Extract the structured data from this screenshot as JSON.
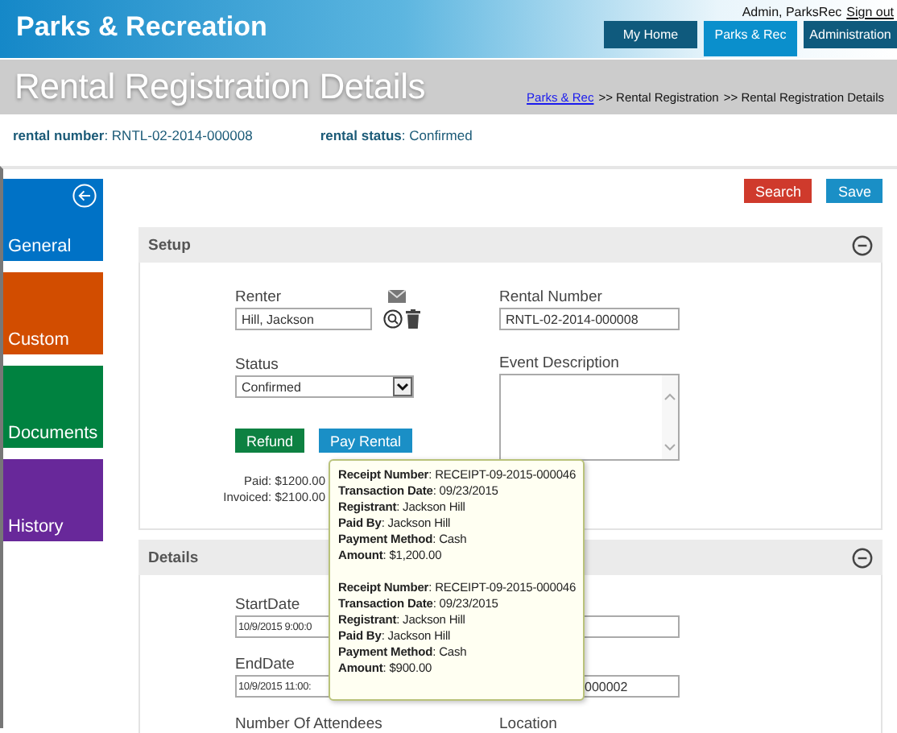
{
  "header": {
    "app_title": "Parks & Recreation",
    "user": "Admin, ParksRec",
    "sign_out": "Sign out",
    "tabs": [
      {
        "label": "My Home",
        "selected": false
      },
      {
        "label": "Parks & Rec",
        "selected": true
      },
      {
        "label": "Administration",
        "selected": false
      }
    ]
  },
  "title_bar": {
    "title": "Rental Registration Details",
    "breadcrumb": [
      {
        "label": "Parks & Rec",
        "kind": "link"
      },
      {
        "label": ">> Rental Registration",
        "kind": "text"
      },
      {
        "label": ">> Rental Registration Details",
        "kind": "text"
      }
    ]
  },
  "summary": [
    "**rental number**: RNTL-02-2014-000008",
    "**rental status**: Confirmed"
  ],
  "sidebar": [
    {
      "label": "General",
      "color": "#0072c6",
      "kind": "back"
    },
    {
      "label": "Custom",
      "color": "#d24d00",
      "kind": "plain"
    },
    {
      "label": "Documents",
      "color": "#008240",
      "kind": "plain"
    },
    {
      "label": "History",
      "color": "#68289a",
      "kind": "plain"
    }
  ],
  "actions": [
    {
      "label": "Search",
      "kind": "danger"
    },
    {
      "label": "Save",
      "kind": "primary"
    }
  ],
  "setup": {
    "title": "Setup",
    "expanded": true,
    "renter": {
      "label": "Renter",
      "value": "Hill, Jackson"
    },
    "status": {
      "label": "Status",
      "value": "Confirmed"
    },
    "buttons": [
      {
        "label": "Refund",
        "kind": "success"
      },
      {
        "label": "Pay Rental",
        "kind": "primary"
      }
    ],
    "paid": "Paid: $1200.00",
    "invoiced": "Invoiced: $2100.00",
    "rental_number": {
      "label": "Rental Number",
      "value": "RNTL-02-2014-000008"
    },
    "event_description": {
      "label": "Event Description"
    }
  },
  "details": {
    "title": "Details",
    "expanded": true,
    "rows": [
      {
        "cells": [
          {
            "label": "StartDate",
            "value": "10/9/2015 9:00:0",
            "kind": "field"
          },
          {
            "kind": "field"
          }
        ]
      },
      {
        "cells": [
          {
            "label": "EndDate",
            "value": "10/9/2015 11:00:",
            "kind": "field"
          },
          {
            "value": "000002",
            "kind": "field"
          }
        ]
      },
      {
        "cells": [
          {
            "label": "Number Of Attendees",
            "kind": "label"
          },
          {
            "label": "Location",
            "kind": "label"
          }
        ]
      }
    ]
  },
  "tooltip": {
    "receipts": [
      {
        "lines": [
          "**Receipt Number**: RECEIPT-09-2015-000046",
          "**Transaction Date**: 09/23/2015",
          "**Registrant**: Jackson Hill",
          "**Paid By**: Jackson Hill",
          "**Payment Method**: Cash",
          "**Amount**: $1,200.00"
        ]
      },
      {
        "lines": [
          "**Receipt Number**: RECEIPT-09-2015-000046",
          "**Transaction Date**: 09/23/2015",
          "**Registrant**: Jackson Hill",
          "**Paid By**: Jackson Hill",
          "**Payment Method**: Cash",
          "**Amount**: $900.00"
        ]
      }
    ]
  }
}
